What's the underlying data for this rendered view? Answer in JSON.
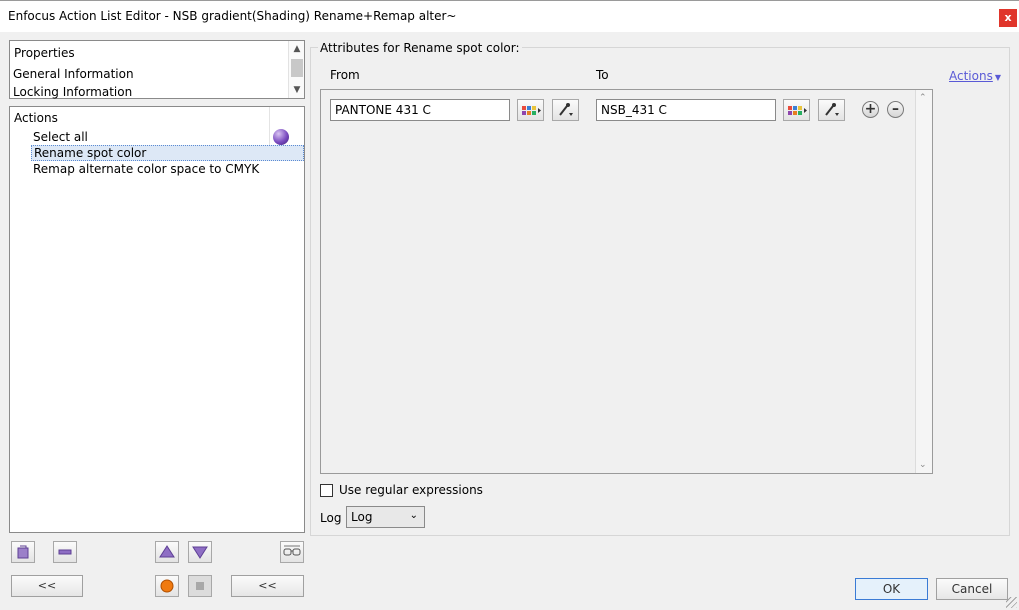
{
  "window": {
    "title": "Enfocus Action List Editor - NSB gradient(Shading) Rename+Remap alter~",
    "close_label": "x"
  },
  "properties_panel": {
    "heading": "Properties",
    "items": [
      "General Information",
      "Locking Information"
    ]
  },
  "actions_panel": {
    "heading": "Actions",
    "items": [
      "Select all",
      "Rename spot color",
      "Remap alternate color space to CMYK"
    ]
  },
  "left_toolbar": {
    "collapse_left_label": "<<",
    "collapse_right_label": "<<",
    "icons": [
      "add-action-icon",
      "remove-action-icon",
      "move-up-icon",
      "move-down-icon",
      "glasses-icon",
      "record-icon",
      "stop-icon"
    ]
  },
  "attributes": {
    "group_title": "Attributes for Rename spot color:",
    "from_header": "From",
    "to_header": "To",
    "actions_link": "Actions",
    "from_value": "PANTONE 431 C",
    "to_value": "NSB_431 C"
  },
  "options": {
    "regex_label": "Use regular expressions",
    "regex_checked": false,
    "log_label": "Log",
    "log_value": "Log"
  },
  "footer": {
    "ok_label": "OK",
    "cancel_label": "Cancel"
  },
  "colors": {
    "accent_link": "#5a5ad6",
    "selection": "#dde8f6",
    "close_red": "#e0352b"
  }
}
